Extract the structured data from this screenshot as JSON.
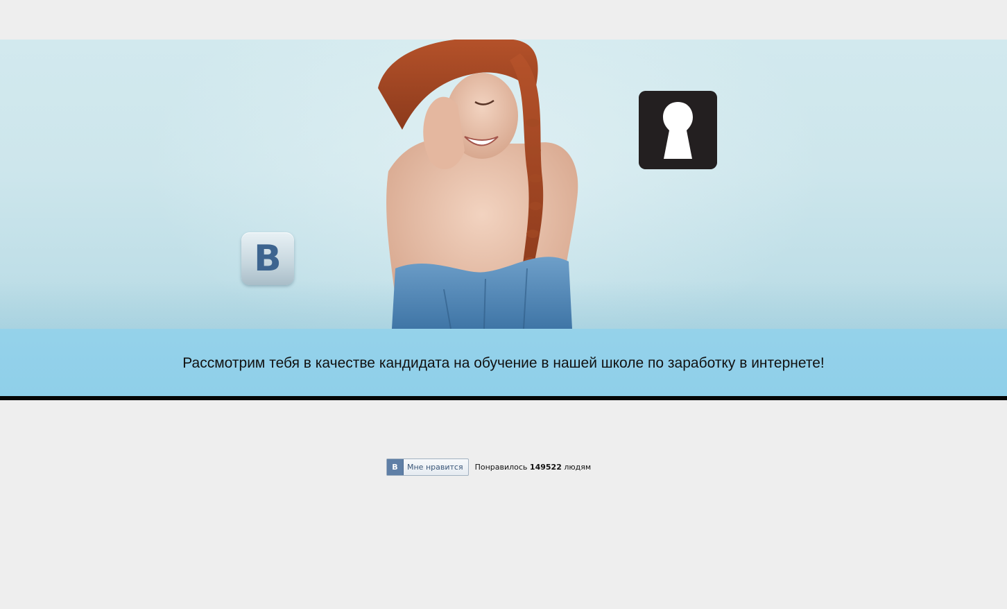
{
  "banner": {
    "vk_logo_letter": "B",
    "photo_icon": "smiling-woman-photo",
    "lock_icon": "keyhole-icon"
  },
  "strip": {
    "text": "Рассмотрим тебя в качестве кандидата на обучение в нашей школе по заработку в интернете!"
  },
  "like_widget": {
    "logo_letter": "B",
    "button_label": "Мне нравится",
    "count_prefix": "Понравилось",
    "count": "149522",
    "count_suffix": "людям"
  },
  "colors": {
    "page_background": "#eeeeee",
    "strip_background": "#8fcfe9",
    "rule": "#050505",
    "vk_blue": "#3d648f"
  }
}
